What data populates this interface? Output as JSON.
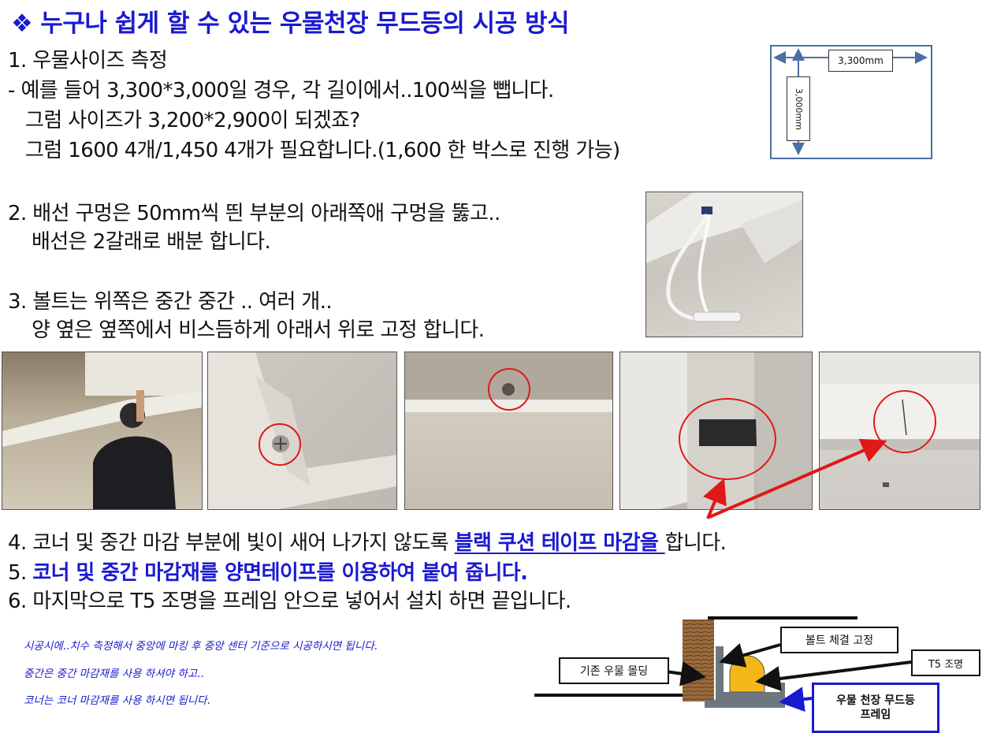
{
  "title": {
    "diamond": "❖",
    "text": "누구나 쉽게 할 수 있는 우물천장 무드등의 시공 방식"
  },
  "step1": {
    "heading": "1. 우물사이즈 측정",
    "line1": "- 예를 들어 3,300*3,000일 경우, 각 길이에서..100씩을 뺍니다.",
    "line2": "그럼 사이즈가 3,200*2,900이 되겠죠?",
    "line3": "그럼 1600 4개/1,450 4개가 필요합니다.(1,600 한 박스로 진행 가능)"
  },
  "diagram": {
    "width_label": "3,300mm",
    "height_label": "3,000mm"
  },
  "step2": {
    "line1": "2. 배선 구멍은 50mm씩 띈 부분의 아래쪽애 구멍을 뚫고..",
    "line2": "배선은 2갈래로 배분 합니다."
  },
  "step3": {
    "line1": "3. 볼트는 위쪽은 중간 중간 .. 여러 개..",
    "line2": "양 옆은 옆쪽에서 비스듬하게 아래서 위로 고정 합니다."
  },
  "step4": {
    "before": "4. 코너 및 중간 마감 부분에 빛이 새어 나가지 않도록 ",
    "highlight": "블랙 쿠션 테이프 마감을 ",
    "after": "합니다."
  },
  "step5": {
    "number": "5. ",
    "text": "코너 및 중간 마감재를 양면테이프를 이용하여 붙여 줍니다."
  },
  "step6": {
    "text": "6. 마지막으로 T5 조명을 프레임 안으로 넣어서 설치 하면 끝입니다."
  },
  "note": {
    "line1": "시공시에..치수 측정해서 중앙에 마킹 후 중앙 센터 기준으로 시공하시면 됩니다.",
    "line2": "중간은 중간 마감재를 사용 하셔야 하고..",
    "line3": "코너는 코너 마감재를 사용 하시면 됩니다."
  },
  "cross_section": {
    "bolt_label": "볼트 체결 고정",
    "molding_label": "기존 우물 몰딩",
    "t5_label": "T5 조명",
    "frame_label_1": "우물 천장 무드등",
    "frame_label_2": "프레임"
  },
  "colors": {
    "title_blue": "#1a1ad0",
    "highlight_red": "#e01818"
  }
}
